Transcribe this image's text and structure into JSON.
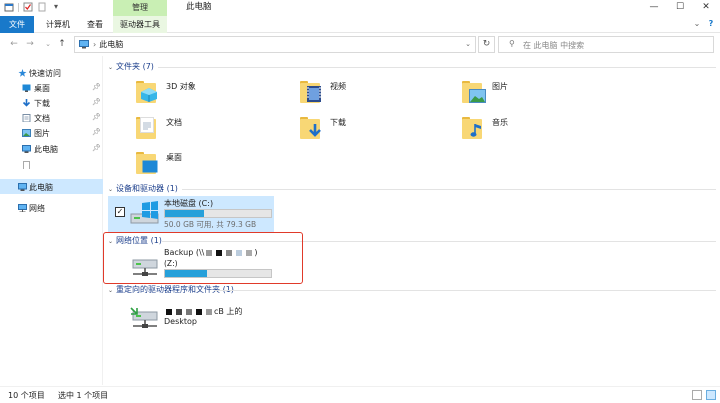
{
  "window": {
    "title": "此电脑",
    "context_tab": "管理",
    "controls": {
      "minimize": "—",
      "maximize": "☐",
      "close": "✕"
    }
  },
  "ribbon": {
    "tabs": [
      {
        "label": "文件"
      },
      {
        "label": "计算机"
      },
      {
        "label": "查看"
      },
      {
        "label": "驱动器工具"
      }
    ]
  },
  "address": {
    "path": "此电脑",
    "separator": "›",
    "search_placeholder": "在 此电脑 中搜索"
  },
  "navigation": {
    "quick_access": "快速访问",
    "items": [
      {
        "label": "桌面",
        "icon": "desktop-icon"
      },
      {
        "label": "下载",
        "icon": "download-icon"
      },
      {
        "label": "文档",
        "icon": "documents-icon"
      },
      {
        "label": "图片",
        "icon": "pictures-icon"
      },
      {
        "label": "此电脑",
        "icon": "this-pc-icon"
      },
      {
        "label": "",
        "icon": "file-icon"
      }
    ],
    "this_pc": "此电脑",
    "network": "网络"
  },
  "content": {
    "folders_header": "文件夹 (7)",
    "folders": [
      {
        "label": "3D 对象"
      },
      {
        "label": "视频"
      },
      {
        "label": "图片"
      },
      {
        "label": "文档"
      },
      {
        "label": "下载"
      },
      {
        "label": "音乐"
      },
      {
        "label": "桌面"
      }
    ],
    "devices_header": "设备和驱动器 (1)",
    "local_disk": {
      "name": "本地磁盘 (C:)",
      "free_text": "50.0 GB 可用, 共 79.3 GB",
      "used_fraction": 0.37
    },
    "network_header": "网络位置 (1)",
    "network_drive": {
      "name_prefix": "Backup (\\\\",
      "name_suffix": ")",
      "letter": "(Z:)",
      "used_fraction": 0.4
    },
    "redirected_header": "重定向的驱动器程序和文件夹 (1)",
    "redirected": {
      "line1_suffix": "cB 上的",
      "line2": "Desktop"
    }
  },
  "status": {
    "count": "10 个项目",
    "selected": "选中 1 个项目"
  },
  "colors": {
    "accent": "#1979ca",
    "selection": "#cde8ff",
    "progress": "#26a0da",
    "highlight_box": "#e03a2a",
    "context_tab": "#c9efb4"
  }
}
